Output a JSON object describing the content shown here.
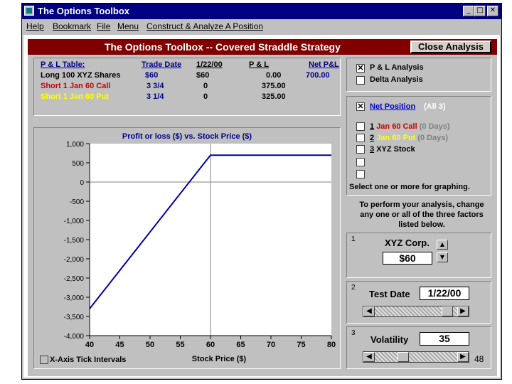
{
  "window": {
    "title": "The Options Toolbox",
    "controls": {
      "minimize": "_",
      "maximize": "□",
      "close": "✕"
    }
  },
  "menubar": [
    "Help",
    "Bookmark",
    "File",
    "Menu",
    "Construct & Analyze A Position"
  ],
  "header": {
    "title": "The Options Toolbox -- Covered Straddle Strategy",
    "close_label": "Close Analysis"
  },
  "pl_table": {
    "headers": [
      "P & L Table:",
      "Trade Date",
      "1/22/00",
      "P & L",
      "Net P&L"
    ],
    "net_pl": "700.00",
    "rows": [
      {
        "name": "Long 100 XYZ Shares",
        "trade_date": "$60",
        "date_val": "$60",
        "pl": "0.00",
        "color": "#000000"
      },
      {
        "name": "Short 1 Jan 60 Call",
        "trade_date": "3  3/4",
        "date_val": "0",
        "pl": "375.00",
        "color": "#cc0000"
      },
      {
        "name": "Short 1 Jan 60 Put",
        "trade_date": "3  1/4",
        "date_val": "0",
        "pl": "325.00",
        "color": "#ffff00"
      }
    ]
  },
  "analysis_options": [
    {
      "label": "P & L Analysis",
      "checked": true
    },
    {
      "label": "Delta Analysis",
      "checked": false
    }
  ],
  "positions": {
    "net": {
      "label": "Net Position",
      "suffix": "(All 3)",
      "checked": true
    },
    "items": [
      {
        "num": "1",
        "label": "Jan 60 Call",
        "suffix": "(0 Days)",
        "color": "#cc0000",
        "checked": false
      },
      {
        "num": "2",
        "label": "Jan 60 Put",
        "suffix": "(0 Days)",
        "color": "#ffff00",
        "checked": false
      },
      {
        "num": "3",
        "label": "XYZ Stock",
        "suffix": "",
        "color": "#000000",
        "checked": false
      },
      {
        "num": "",
        "label": "",
        "suffix": "",
        "color": "#000000",
        "checked": false
      },
      {
        "num": "",
        "label": "",
        "suffix": "",
        "color": "#000000",
        "checked": false
      }
    ],
    "footer": "Select one or more for graphing."
  },
  "instructions": "To perform your analysis, change any one or all of the three factors listed below.",
  "factors": {
    "stock": {
      "num": "1",
      "label": "XYZ Corp.",
      "value": "$60"
    },
    "date": {
      "num": "2",
      "label": "Test Date",
      "value": "1/22/00",
      "slider_fraction": 0.94
    },
    "vol": {
      "num": "3",
      "label": "Volatility",
      "value": "35",
      "slider_fraction": 0.32
    }
  },
  "chart_checkbox_label": "X-Axis Tick Intervals",
  "page_number": "48",
  "colors": {
    "accent_header": "#800000",
    "line": "#0000aa",
    "title_bar": "#000080"
  },
  "chart_data": {
    "type": "line",
    "title": "Profit or loss ($) vs. Stock Price ($)",
    "xlabel": "Stock Price ($)",
    "ylabel": "",
    "xlim": [
      40,
      80
    ],
    "ylim": [
      -4000,
      1000
    ],
    "xticks": [
      40,
      45,
      50,
      55,
      60,
      65,
      70,
      75,
      80
    ],
    "yticks": [
      1000,
      500,
      0,
      -500,
      -1000,
      -1500,
      -2000,
      -2500,
      -3000,
      -3500,
      -4000
    ],
    "ytick_labels": [
      "1,000",
      "500",
      "0",
      "-500",
      "-1,000",
      "-1,500",
      "-2,000",
      "-2,500",
      "-3,000",
      "-3,500",
      "-4,000"
    ],
    "reference_lines": {
      "y": 0,
      "x": 60
    },
    "series": [
      {
        "x": [
          40,
          60,
          80
        ],
        "y": [
          -3300,
          700,
          700
        ]
      }
    ]
  }
}
